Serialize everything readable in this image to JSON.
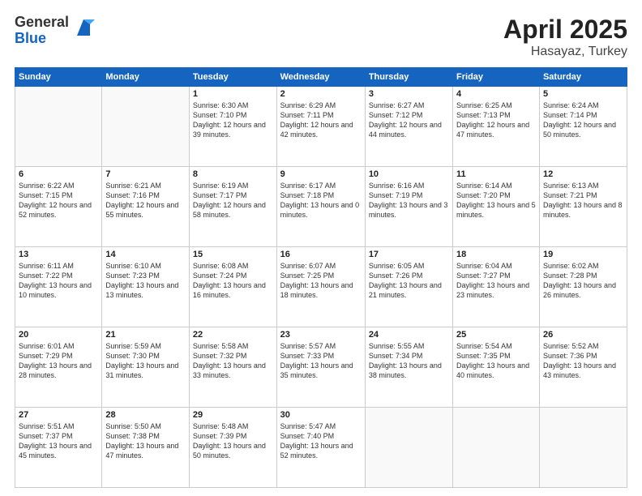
{
  "logo": {
    "general": "General",
    "blue": "Blue"
  },
  "title": {
    "month": "April 2025",
    "location": "Hasayaz, Turkey"
  },
  "headers": [
    "Sunday",
    "Monday",
    "Tuesday",
    "Wednesday",
    "Thursday",
    "Friday",
    "Saturday"
  ],
  "weeks": [
    [
      {
        "day": "",
        "info": ""
      },
      {
        "day": "",
        "info": ""
      },
      {
        "day": "1",
        "info": "Sunrise: 6:30 AM\nSunset: 7:10 PM\nDaylight: 12 hours and 39 minutes."
      },
      {
        "day": "2",
        "info": "Sunrise: 6:29 AM\nSunset: 7:11 PM\nDaylight: 12 hours and 42 minutes."
      },
      {
        "day": "3",
        "info": "Sunrise: 6:27 AM\nSunset: 7:12 PM\nDaylight: 12 hours and 44 minutes."
      },
      {
        "day": "4",
        "info": "Sunrise: 6:25 AM\nSunset: 7:13 PM\nDaylight: 12 hours and 47 minutes."
      },
      {
        "day": "5",
        "info": "Sunrise: 6:24 AM\nSunset: 7:14 PM\nDaylight: 12 hours and 50 minutes."
      }
    ],
    [
      {
        "day": "6",
        "info": "Sunrise: 6:22 AM\nSunset: 7:15 PM\nDaylight: 12 hours and 52 minutes."
      },
      {
        "day": "7",
        "info": "Sunrise: 6:21 AM\nSunset: 7:16 PM\nDaylight: 12 hours and 55 minutes."
      },
      {
        "day": "8",
        "info": "Sunrise: 6:19 AM\nSunset: 7:17 PM\nDaylight: 12 hours and 58 minutes."
      },
      {
        "day": "9",
        "info": "Sunrise: 6:17 AM\nSunset: 7:18 PM\nDaylight: 13 hours and 0 minutes."
      },
      {
        "day": "10",
        "info": "Sunrise: 6:16 AM\nSunset: 7:19 PM\nDaylight: 13 hours and 3 minutes."
      },
      {
        "day": "11",
        "info": "Sunrise: 6:14 AM\nSunset: 7:20 PM\nDaylight: 13 hours and 5 minutes."
      },
      {
        "day": "12",
        "info": "Sunrise: 6:13 AM\nSunset: 7:21 PM\nDaylight: 13 hours and 8 minutes."
      }
    ],
    [
      {
        "day": "13",
        "info": "Sunrise: 6:11 AM\nSunset: 7:22 PM\nDaylight: 13 hours and 10 minutes."
      },
      {
        "day": "14",
        "info": "Sunrise: 6:10 AM\nSunset: 7:23 PM\nDaylight: 13 hours and 13 minutes."
      },
      {
        "day": "15",
        "info": "Sunrise: 6:08 AM\nSunset: 7:24 PM\nDaylight: 13 hours and 16 minutes."
      },
      {
        "day": "16",
        "info": "Sunrise: 6:07 AM\nSunset: 7:25 PM\nDaylight: 13 hours and 18 minutes."
      },
      {
        "day": "17",
        "info": "Sunrise: 6:05 AM\nSunset: 7:26 PM\nDaylight: 13 hours and 21 minutes."
      },
      {
        "day": "18",
        "info": "Sunrise: 6:04 AM\nSunset: 7:27 PM\nDaylight: 13 hours and 23 minutes."
      },
      {
        "day": "19",
        "info": "Sunrise: 6:02 AM\nSunset: 7:28 PM\nDaylight: 13 hours and 26 minutes."
      }
    ],
    [
      {
        "day": "20",
        "info": "Sunrise: 6:01 AM\nSunset: 7:29 PM\nDaylight: 13 hours and 28 minutes."
      },
      {
        "day": "21",
        "info": "Sunrise: 5:59 AM\nSunset: 7:30 PM\nDaylight: 13 hours and 31 minutes."
      },
      {
        "day": "22",
        "info": "Sunrise: 5:58 AM\nSunset: 7:32 PM\nDaylight: 13 hours and 33 minutes."
      },
      {
        "day": "23",
        "info": "Sunrise: 5:57 AM\nSunset: 7:33 PM\nDaylight: 13 hours and 35 minutes."
      },
      {
        "day": "24",
        "info": "Sunrise: 5:55 AM\nSunset: 7:34 PM\nDaylight: 13 hours and 38 minutes."
      },
      {
        "day": "25",
        "info": "Sunrise: 5:54 AM\nSunset: 7:35 PM\nDaylight: 13 hours and 40 minutes."
      },
      {
        "day": "26",
        "info": "Sunrise: 5:52 AM\nSunset: 7:36 PM\nDaylight: 13 hours and 43 minutes."
      }
    ],
    [
      {
        "day": "27",
        "info": "Sunrise: 5:51 AM\nSunset: 7:37 PM\nDaylight: 13 hours and 45 minutes."
      },
      {
        "day": "28",
        "info": "Sunrise: 5:50 AM\nSunset: 7:38 PM\nDaylight: 13 hours and 47 minutes."
      },
      {
        "day": "29",
        "info": "Sunrise: 5:48 AM\nSunset: 7:39 PM\nDaylight: 13 hours and 50 minutes."
      },
      {
        "day": "30",
        "info": "Sunrise: 5:47 AM\nSunset: 7:40 PM\nDaylight: 13 hours and 52 minutes."
      },
      {
        "day": "",
        "info": ""
      },
      {
        "day": "",
        "info": ""
      },
      {
        "day": "",
        "info": ""
      }
    ]
  ]
}
